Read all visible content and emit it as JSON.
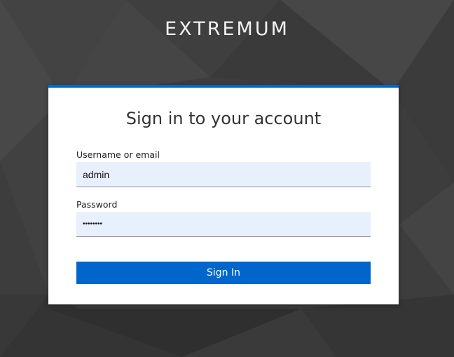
{
  "brand": {
    "name": "EXTREMUM"
  },
  "login": {
    "title": "Sign in to your account",
    "username_label": "Username or email",
    "username_value": "admin",
    "password_label": "Password",
    "password_value": "••••••••",
    "submit_label": "Sign In"
  },
  "colors": {
    "accent": "#0066cc",
    "background": "#3a3a3a",
    "input_fill": "#e8f0fe"
  }
}
